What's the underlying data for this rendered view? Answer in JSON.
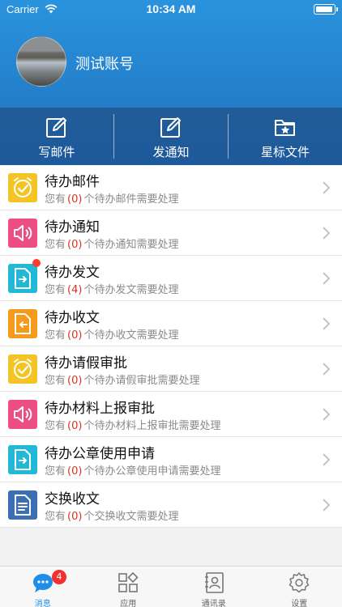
{
  "status_bar": {
    "carrier": "Carrier",
    "time": "10:34 AM"
  },
  "profile": {
    "account_name": "测试账号"
  },
  "actions": [
    {
      "label": "写邮件",
      "icon": "edit-icon"
    },
    {
      "label": "发通知",
      "icon": "edit-icon"
    },
    {
      "label": "星标文件",
      "icon": "starred-folder-icon"
    }
  ],
  "tasks": [
    {
      "title": "待办邮件",
      "prefix": "您有",
      "count": "(0)",
      "suffix": "个待办邮件需要处理",
      "icon": "clock-icon",
      "color": "#f3c423"
    },
    {
      "title": "待办通知",
      "prefix": "您有",
      "count": "(0)",
      "suffix": "个待办通知需要处理",
      "icon": "speaker-icon",
      "color": "#ee4e86"
    },
    {
      "title": "待办发文",
      "prefix": "您有",
      "count": "(4)",
      "suffix": "个待办发文需要处理",
      "icon": "document-out-icon",
      "color": "#22b9d6",
      "has_dot": true
    },
    {
      "title": "待办收文",
      "prefix": "您有",
      "count": "(0)",
      "suffix": "个待办收文需要处理",
      "icon": "document-in-icon",
      "color": "#f59a1b"
    },
    {
      "title": "待办请假审批",
      "prefix": "您有",
      "count": "(0)",
      "suffix": "个待办请假审批需要处理",
      "icon": "clock-icon",
      "color": "#f3c423"
    },
    {
      "title": "待办材料上报审批",
      "prefix": "您有",
      "count": "(0)",
      "suffix": "个待办材料上报审批需要处理",
      "icon": "speaker-icon",
      "color": "#ee4e86"
    },
    {
      "title": "待办公章使用申请",
      "prefix": "您有",
      "count": "(0)",
      "suffix": "个待办公章使用申请需要处理",
      "icon": "document-out-icon",
      "color": "#22b9d6"
    },
    {
      "title": "交换收文",
      "prefix": "您有",
      "count": "(0)",
      "suffix": "个交换收文需要处理",
      "icon": "document-list-icon",
      "color": "#3a6fb5"
    }
  ],
  "tabs": [
    {
      "label": "消息",
      "icon": "chat-icon",
      "badge": "4",
      "active": true
    },
    {
      "label": "应用",
      "icon": "apps-grid-icon"
    },
    {
      "label": "通讯录",
      "icon": "contacts-icon"
    },
    {
      "label": "设置",
      "icon": "settings-gear-icon"
    }
  ],
  "colors": {
    "header_blue": "#2584cf",
    "action_bar": "#1d5a9c",
    "tab_active": "#1e8ee8",
    "count_red": "#e0301e"
  }
}
